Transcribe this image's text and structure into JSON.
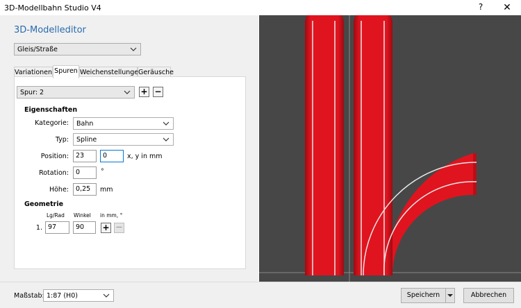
{
  "window": {
    "title": "3D-Modellbahn Studio V4",
    "help_glyph": "?",
    "close_glyph": "✕"
  },
  "editor": {
    "title": "3D-Modelleditor",
    "object_type": "Gleis/Straße",
    "tabs": [
      {
        "label": "Variationen"
      },
      {
        "label": "Spuren",
        "active": true
      },
      {
        "label": "Weichenstellungen"
      },
      {
        "label": "Geräusche"
      }
    ]
  },
  "spuren": {
    "selected_track": "Spur: 2",
    "add_glyph": "+",
    "remove_glyph": "−",
    "properties": {
      "heading": "Eigenschaften",
      "kategorie_label": "Kategorie:",
      "kategorie_value": "Bahn",
      "typ_label": "Typ:",
      "typ_value": "Spline",
      "position_label": "Position:",
      "position_x": "23",
      "position_y": "0",
      "position_unit": "x, y in mm",
      "rotation_label": "Rotation:",
      "rotation_value": "0",
      "rotation_unit": "°",
      "hoehe_label": "Höhe:",
      "hoehe_value": "0,25",
      "hoehe_unit": "mm"
    },
    "geometry": {
      "heading": "Geometrie",
      "col_length": "Lg/Rad",
      "col_angle": "Winkel",
      "col_unit": "in mm, °",
      "rows": [
        {
          "index": "1.",
          "length": "97",
          "angle": "90"
        }
      ],
      "add_glyph": "+",
      "remove_glyph": "—"
    }
  },
  "footer": {
    "scale_label": "Maßstab:",
    "scale_value": "1:87 (H0)",
    "save_label": "Speichern",
    "cancel_label": "Abbrechen"
  },
  "colors": {
    "track_red": "#e0141f",
    "viewport_bg": "#474747",
    "accent_blue": "#2a6ab0"
  }
}
